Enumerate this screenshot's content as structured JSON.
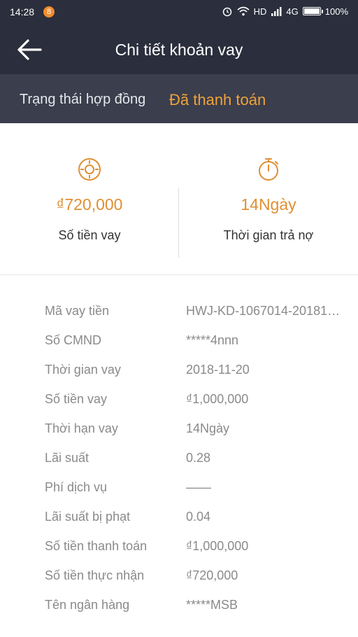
{
  "status_bar": {
    "time": "14:28",
    "notification_badge": "8",
    "network": "HD",
    "network2": "4G",
    "battery": "100%"
  },
  "app_bar": {
    "title": "Chi tiết khoản vay"
  },
  "contract_status": {
    "label": "Trạng thái hợp đồng",
    "value": "Đã thanh toán"
  },
  "summary": {
    "amount_value": "₫720,000",
    "amount_label": "Số tiền vay",
    "duration_value": "14Ngày",
    "duration_label": "Thời gian trả nợ"
  },
  "details": [
    {
      "label": "Mã vay tiền",
      "value": "HWJ-KD-1067014-20181…"
    },
    {
      "label": "Số CMND",
      "value": "*****4nnn"
    },
    {
      "label": "Thời gian vay",
      "value": "2018-11-20"
    },
    {
      "label": "Số tiền vay",
      "value": "₫1,000,000"
    },
    {
      "label": "Thời hạn vay",
      "value": "14Ngày"
    },
    {
      "label": "Lãi suất",
      "value": "0.28"
    },
    {
      "label": "Phí dịch vụ",
      "value": "——"
    },
    {
      "label": "Lãi suất bị phạt",
      "value": "0.04"
    },
    {
      "label": "Số tiền thanh toán",
      "value": "₫1,000,000"
    },
    {
      "label": "Số tiền thực nhận",
      "value": "₫720,000"
    },
    {
      "label": "Tên ngân hàng",
      "value": "*****MSB"
    }
  ],
  "colors": {
    "header_bg": "#2b2e3c",
    "tab_bg": "#3a3e4d",
    "accent": "#f0a23a",
    "amount": "#e08f33"
  }
}
